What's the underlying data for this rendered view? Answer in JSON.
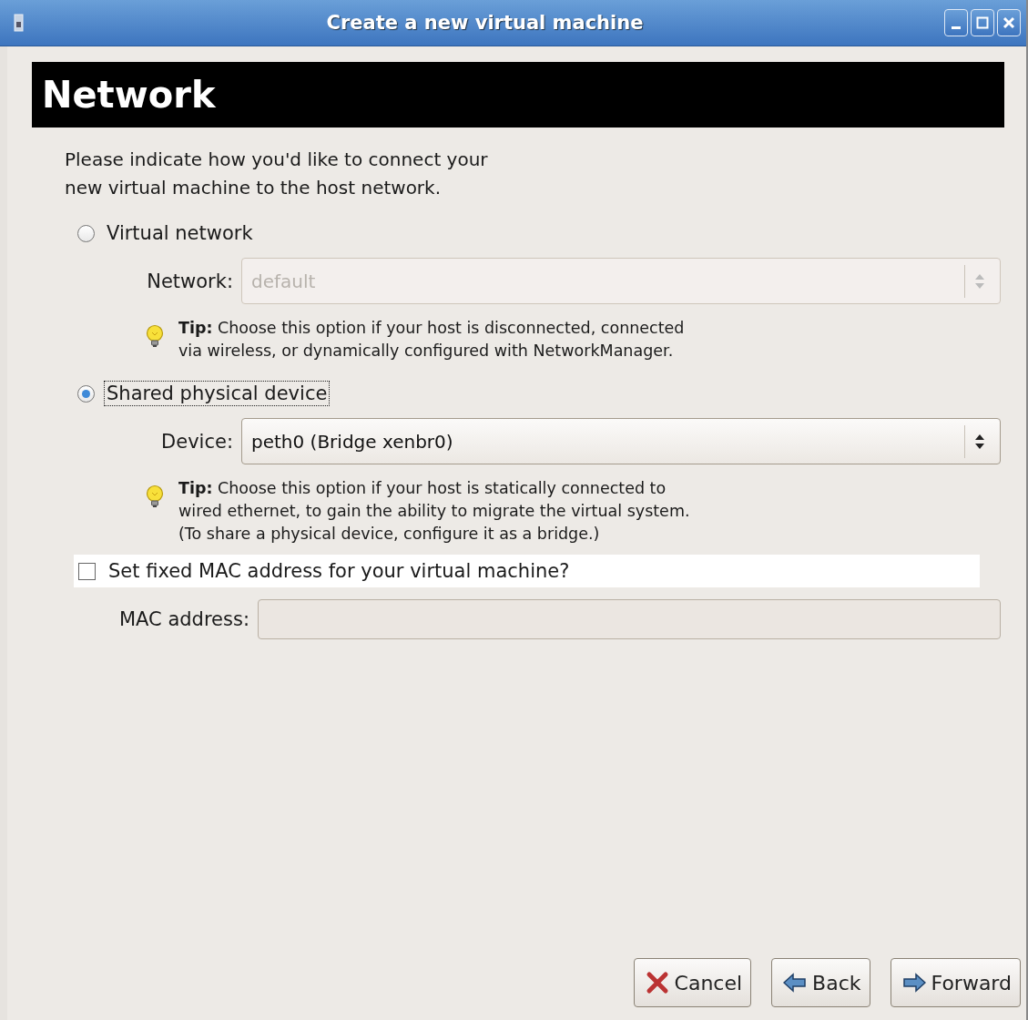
{
  "window": {
    "title": "Create a new virtual machine"
  },
  "header": {
    "title": "Network"
  },
  "intro": "Please indicate how you'd like to connect your\nnew virtual machine to the host network.",
  "options": [
    {
      "label": "Virtual network",
      "selected": false,
      "focused": false,
      "field": {
        "label": "Network:",
        "value": "default",
        "disabled": true
      },
      "tip": "**Tip:** Choose this option if your host is disconnected, connected\nvia wireless, or dynamically configured with NetworkManager."
    },
    {
      "label": "Shared physical device",
      "selected": true,
      "focused": true,
      "field": {
        "label": "Device:",
        "value": "peth0 (Bridge xenbr0)",
        "disabled": false
      },
      "tip": "**Tip:** Choose this option if your host is statically connected to\nwired ethernet, to gain the ability to migrate the virtual system.\n(To share a physical device, configure it as a bridge.)"
    }
  ],
  "mac": {
    "checkbox": {
      "label": "Set fixed MAC address for your virtual machine?",
      "checked": false,
      "hovered": true
    },
    "field": {
      "label": "MAC address:",
      "disabled": true
    }
  },
  "buttons": [
    {
      "label": "Cancel",
      "kind": "cancel"
    },
    {
      "label": "Back",
      "kind": "back"
    },
    {
      "label": "Forward",
      "kind": "forward"
    }
  ]
}
